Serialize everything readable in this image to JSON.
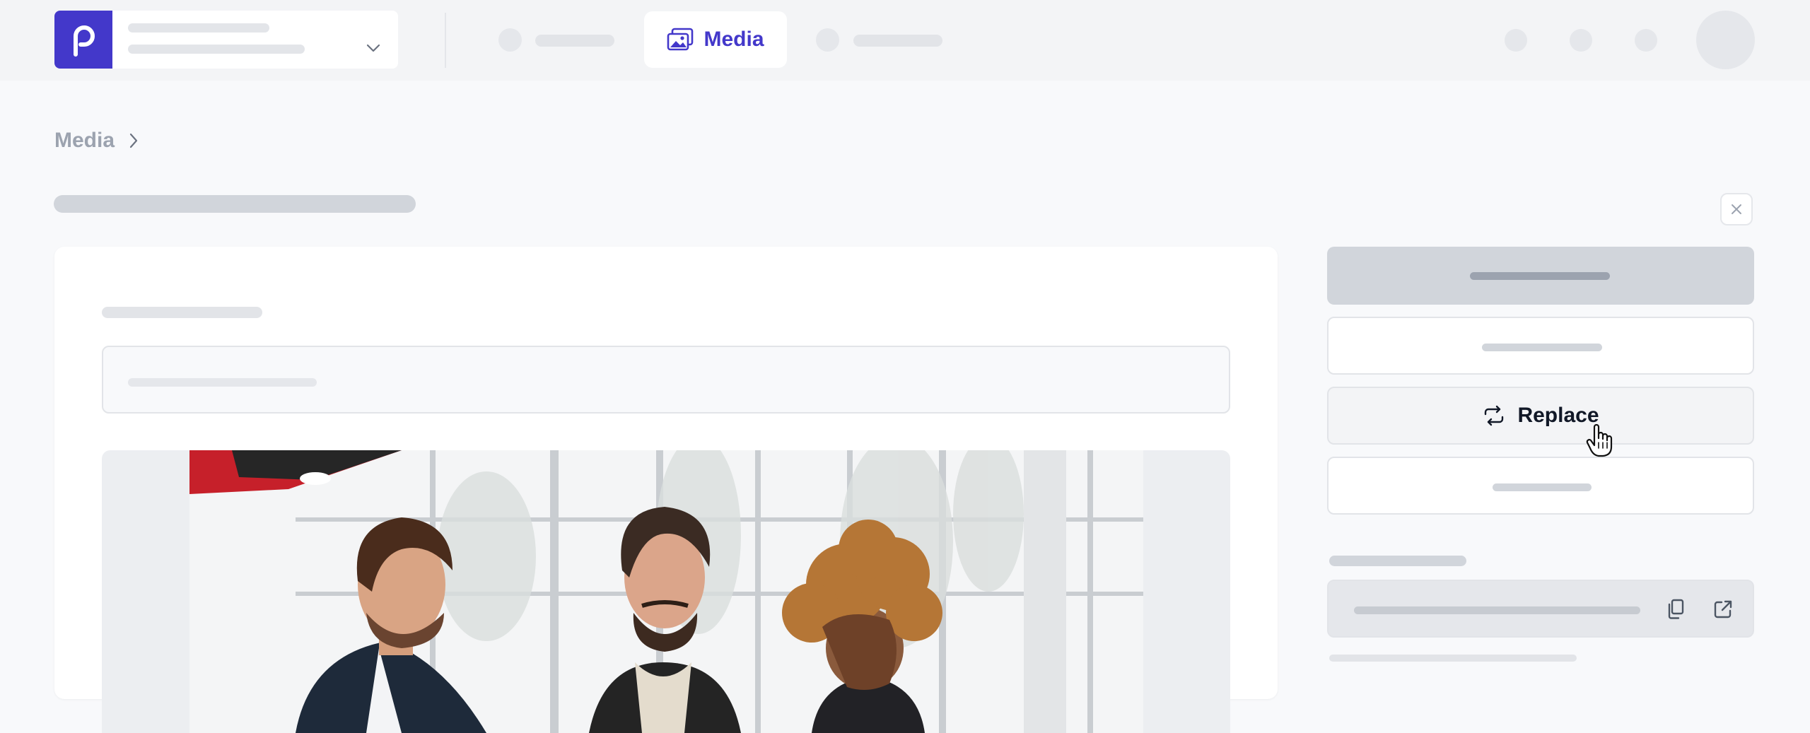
{
  "nav": {
    "active_label": "Media",
    "active_icon": "media-icon"
  },
  "breadcrumb": {
    "items": [
      "Media"
    ]
  },
  "sidebar_actions": {
    "replace_label": "Replace"
  },
  "colors": {
    "brand": "#4338ca",
    "background": "#f8f9fb",
    "placeholder": "#e2e4e8"
  }
}
